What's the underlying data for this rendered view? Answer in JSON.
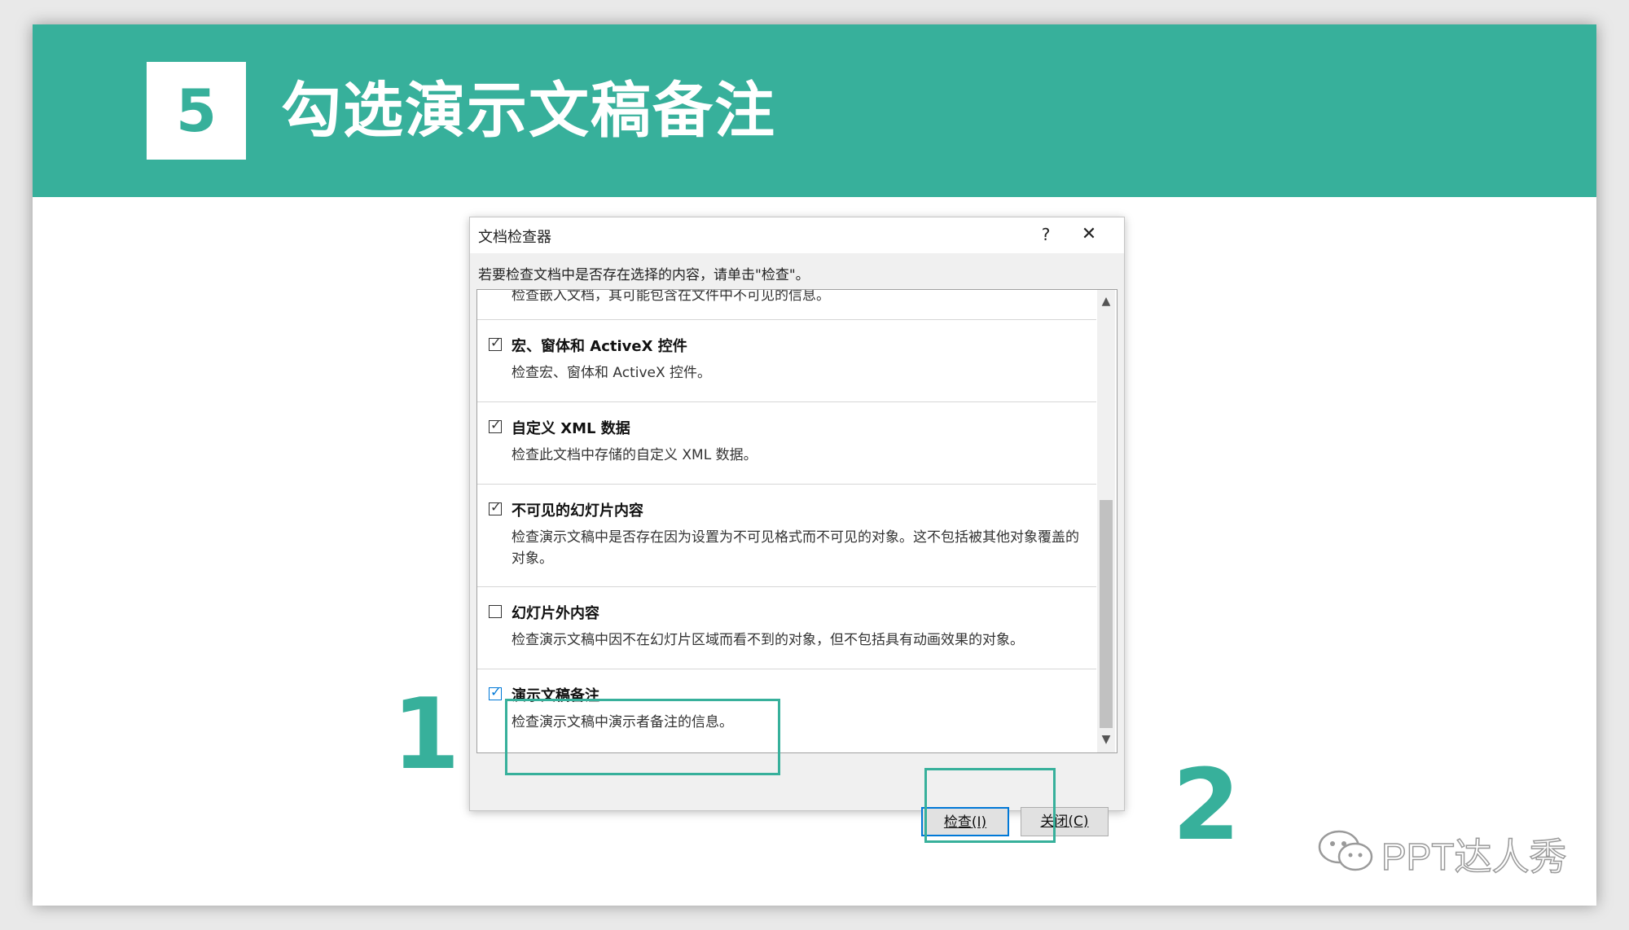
{
  "header": {
    "step_number": "5",
    "title": "勾选演示文稿备注",
    "accent_color": "#37b09b"
  },
  "dialog": {
    "title": "文档检查器",
    "help_label": "?",
    "close_label": "✕",
    "instruction": "若要检查文档中是否存在选择的内容，请单击\"检查\"。",
    "partial_text": "检查嵌入文档，其可能包含在文件中不可见的信息。",
    "items": [
      {
        "title": "宏、窗体和 ActiveX 控件",
        "description": "检查宏、窗体和 ActiveX 控件。",
        "checked": true
      },
      {
        "title": "自定义 XML 数据",
        "description": "检查此文档中存储的自定义 XML 数据。",
        "checked": true
      },
      {
        "title": "不可见的幻灯片内容",
        "description": "检查演示文稿中是否存在因为设置为不可见格式而不可见的对象。这不包括被其他对象覆盖的对象。",
        "checked": true
      },
      {
        "title": "幻灯片外内容",
        "description": "检查演示文稿中因不在幻灯片区域而看不到的对象，但不包括具有动画效果的对象。",
        "checked": false
      },
      {
        "title": "演示文稿备注",
        "description": "检查演示文稿中演示者备注的信息。",
        "checked": true
      }
    ],
    "scroll_up_icon": "chevron-up-icon",
    "scroll_down_icon": "chevron-down-icon",
    "buttons": {
      "inspect": "检查(I)",
      "close": "关闭(C)"
    }
  },
  "annotations": {
    "step1": "1",
    "step2": "2"
  },
  "watermark": {
    "icon": "wechat-icon",
    "text": "PPT达人秀"
  }
}
